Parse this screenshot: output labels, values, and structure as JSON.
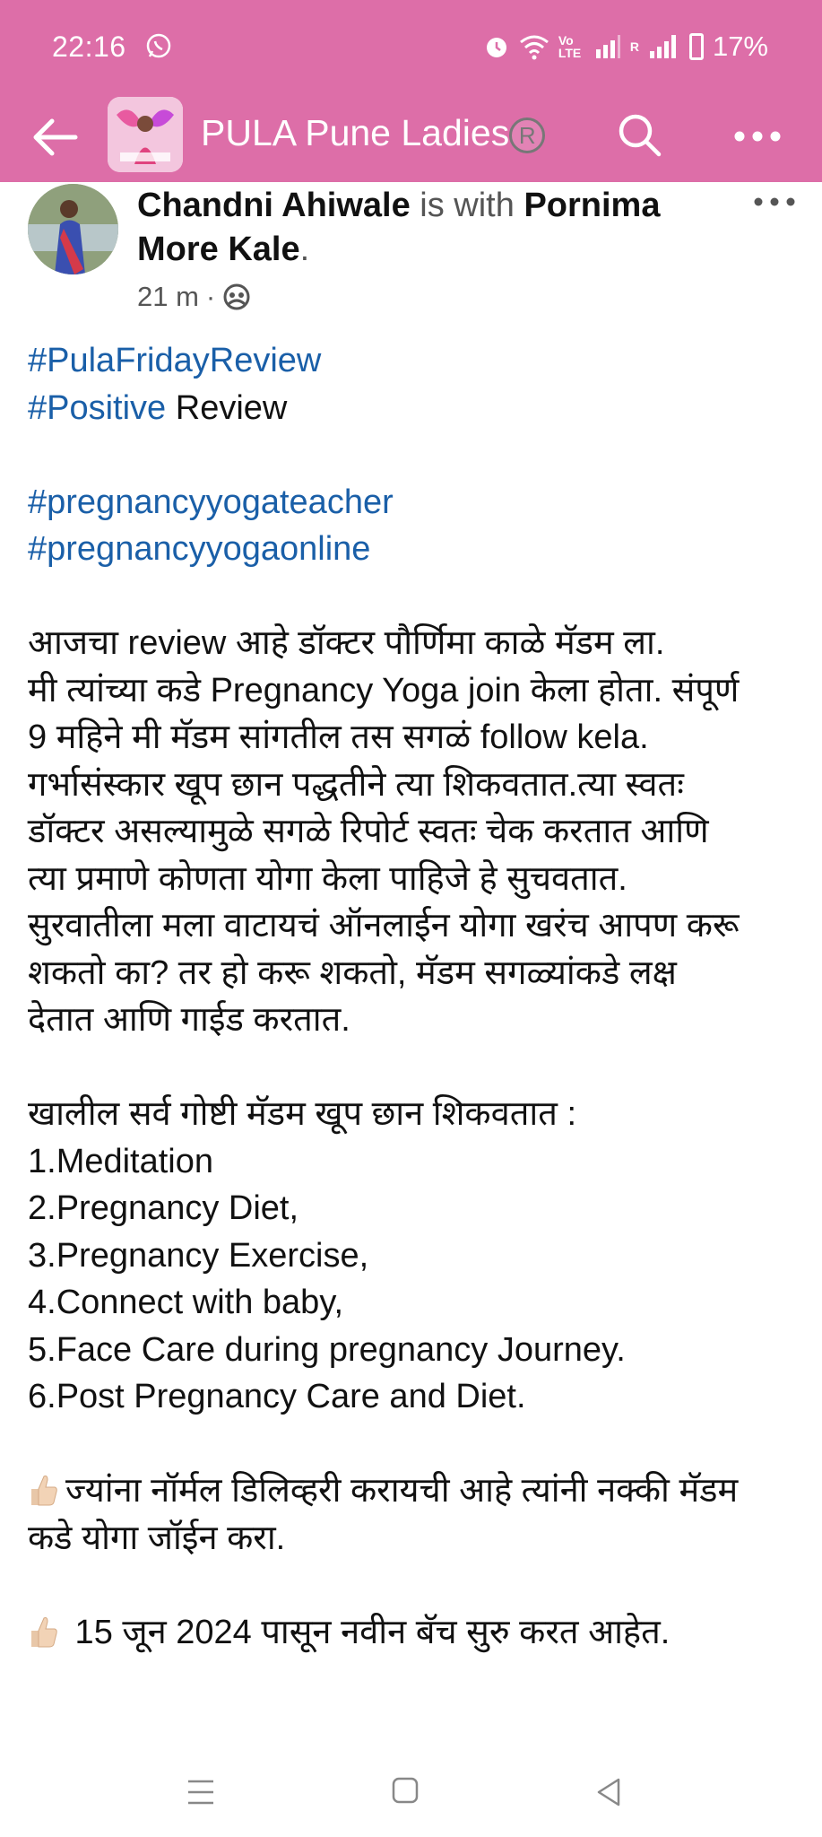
{
  "status_bar": {
    "time": "22:16",
    "volte_label": "Vo LTE",
    "roaming_label": "R",
    "battery": "17%"
  },
  "app_bar": {
    "title": "PULA Pune Ladies",
    "reg_mark": "R"
  },
  "post": {
    "author": "Chandni Ahiwale",
    "with_text": " is with ",
    "tagged": "Pornima More Kale",
    "tagged_suffix": ".",
    "time_ago": "21 m",
    "separator": "·",
    "lines": {
      "hashtag1": "#PulaFridayReview",
      "hashtag2": "#Positive",
      "hashtag2_rest": " Review",
      "hashtag3": "#pregnancyyogateacher",
      "hashtag4": "#pregnancyyogaonline",
      "para1": [
        "आजचा review आहे डॉक्टर पौर्णिमा काळे मॅडम ला.",
        "मी त्यांच्या कडे Pregnancy Yoga  join केला होता. संपूर्ण",
        "9 महिने मी मॅडम सांगतील तस सगळं follow kela.",
        "गर्भासंस्कार खूप छान पद्धतीने त्या शिकवतात.त्या स्वतः",
        "डॉक्टर असल्यामुळे सगळे रिपोर्ट स्वतः चेक करतात आणि",
        "त्या प्रमाणे कोणता योगा केला पाहिजे हे सुचवतात.",
        "सुरवातीला मला वाटायचं ऑनलाईन योगा खरंच आपण करू",
        "शकतो का? तर हो करू शकतो, मॅडम सगळ्यांकडे लक्ष",
        "देतात आणि गाईड करतात."
      ],
      "list_intro": "खालील सर्व गोष्टी मॅडम खूप छान शिकवतात :",
      "list_items": [
        "1.Meditation",
        "2.Pregnancy Diet,",
        "3.Pregnancy Exercise,",
        "4.Connect with baby,",
        "5.Face Care during pregnancy Journey.",
        "6.Post Pregnancy Care and Diet."
      ],
      "point1_line1": "ज्यांना नॉर्मल डिलिव्हरी करायची आहे त्यांनी नक्की मॅडम",
      "point1_line2": "कडे योगा जॉईन करा.",
      "point2": " 15 जून 2024 पासून नवीन बॅच सुरु करत आहेत."
    }
  },
  "colors": {
    "header_bg": "#dd6ea8",
    "hashtag": "#1a5fa8"
  },
  "icons": [
    "whatsapp-icon",
    "alarm-icon",
    "wifi-icon",
    "signal-icon",
    "battery-icon",
    "back-arrow-icon",
    "search-icon",
    "more-icon",
    "globe-icon",
    "thumbs-up-icon",
    "menu-icon",
    "home-icon",
    "nav-back-icon"
  ]
}
